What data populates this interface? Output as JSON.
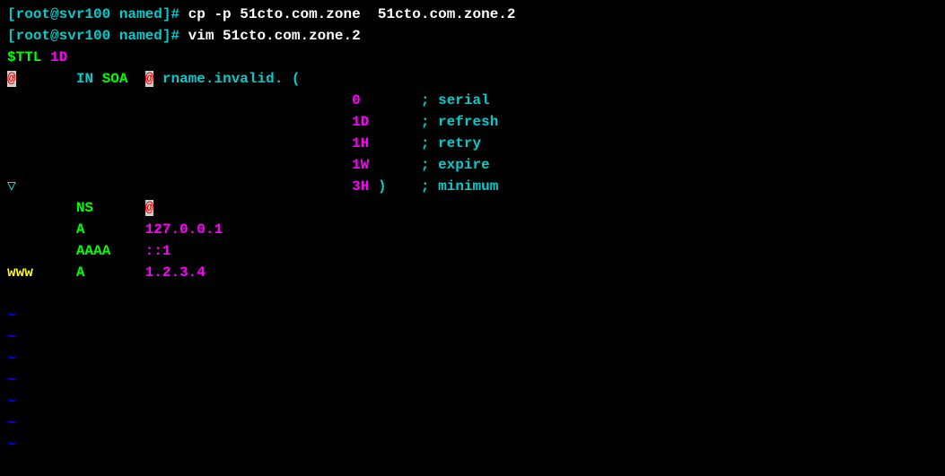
{
  "prompts": {
    "line1_prompt": "[root@svr100 named]# ",
    "line1_cmd": "cp -p 51cto.com.zone  51cto.com.zone.2",
    "line2_prompt": "[root@svr100 named]# ",
    "line2_cmd": "vim 51cto.com.zone.2"
  },
  "zone": {
    "ttl_label": "$TTL",
    "ttl_value": "1D",
    "at1": "@",
    "in": "IN",
    "soa": "SOA",
    "at2": "@",
    "rname": "rname.invalid. (",
    "serial_val": "0",
    "serial_comment": "; serial",
    "refresh_val": "1D",
    "refresh_comment": "; refresh",
    "retry_val": "1H",
    "retry_comment": "; retry",
    "expire_val": "1W",
    "expire_comment": "; expire",
    "minimum_val": "3H",
    "minimum_paren": " )",
    "minimum_comment": "; minimum",
    "ns": "NS",
    "ns_at": "@",
    "a1": "A",
    "a1_val": "127.0.0.1",
    "aaaa": "AAAA",
    "aaaa_val": "::1",
    "www": "www",
    "a2": "A",
    "a2_val": "1.2.3.4"
  },
  "tilde": "~",
  "marker": "▽"
}
